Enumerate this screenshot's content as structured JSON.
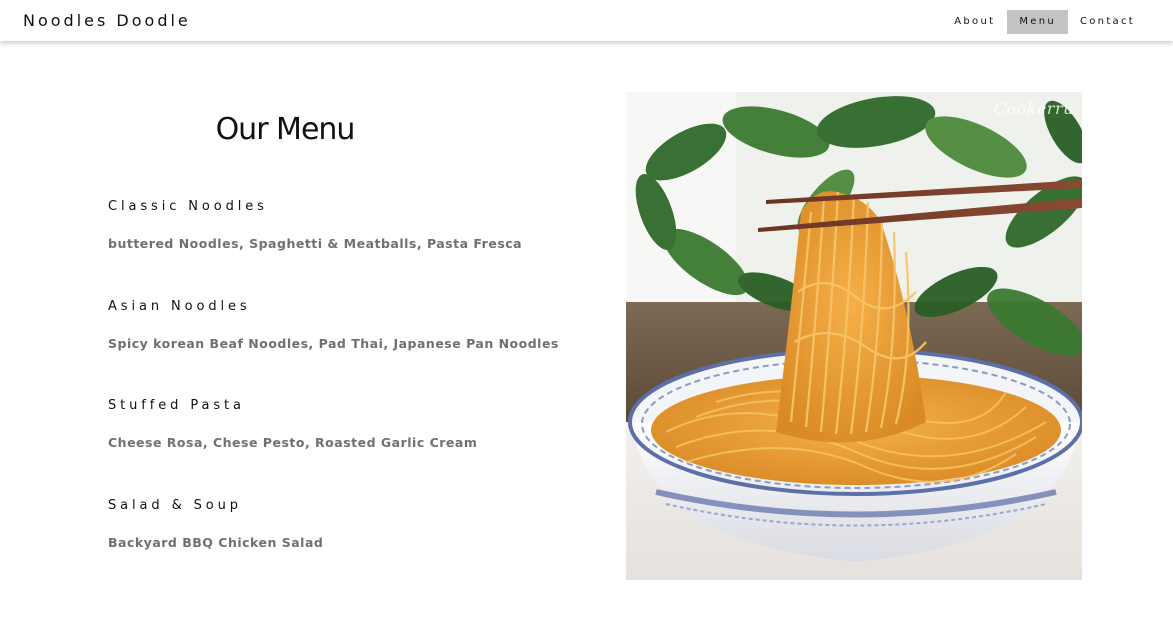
{
  "header": {
    "brand": "Noodles  Doodle",
    "nav": [
      {
        "label": "About",
        "active": false
      },
      {
        "label": "Menu",
        "active": true
      },
      {
        "label": "Contact",
        "active": false
      }
    ]
  },
  "main": {
    "title": "Our Menu",
    "sections": [
      {
        "title": "Classic Noodles",
        "items": "buttered Noodles, Spaghetti & Meatballs, Pasta Fresca"
      },
      {
        "title": "Asian Noodles",
        "items": "Spicy korean Beaf Noodles, Pad Thai, Japanese Pan Noodles"
      },
      {
        "title": "Stuffed Pasta",
        "items": "Cheese Rosa, Chese Pesto, Roasted Garlic Cream"
      },
      {
        "title": "Salad & Soup",
        "items": "Backyard BBQ Chicken Salad"
      }
    ]
  },
  "photo": {
    "watermark": "Cookerru",
    "subject": "noodles-bowl-chopsticks"
  },
  "colors": {
    "nav_active_bg": "#c4c4c4",
    "heading_text": "#111111",
    "item_text": "#707070"
  }
}
